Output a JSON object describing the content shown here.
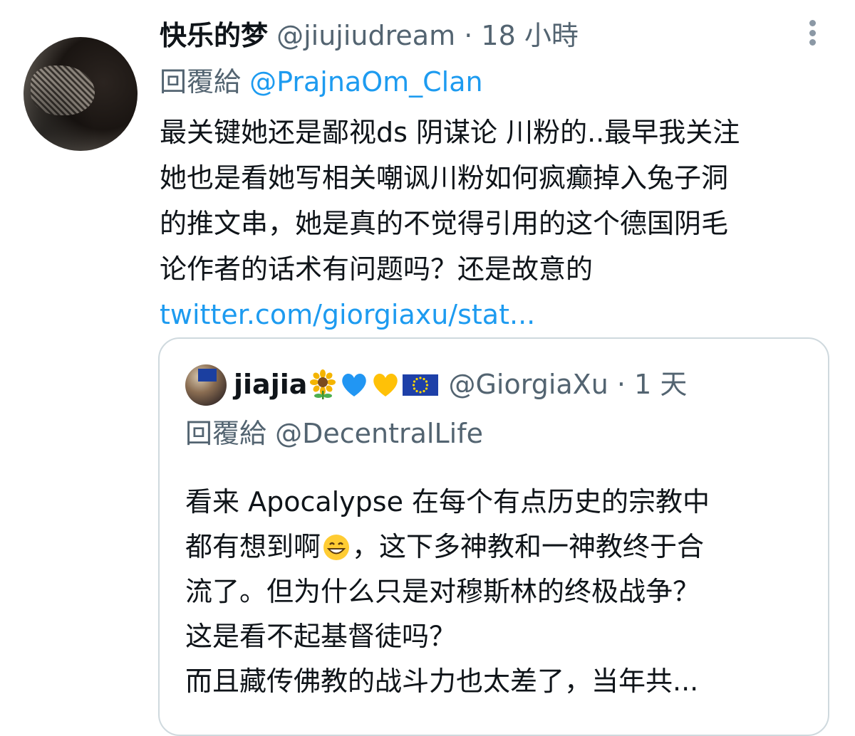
{
  "tweet": {
    "display_name": "快乐的梦",
    "handle": "@jiujiudream",
    "separator": "·",
    "time": "18 小時",
    "reply_prefix": "回覆給",
    "reply_to": "@PrajnaOm_Clan",
    "text_lines": [
      "最关键她还是鄙视ds 阴谋论 川粉的..最早我关注",
      "她也是看她写相关嘲讽川粉如何疯癫掉入兔子洞",
      "的推文串，她是真的不觉得引用的这个德国阴毛",
      "论作者的话术有问题吗？还是故意的"
    ],
    "link": "twitter.com/giorgiaxu/stat..."
  },
  "quote": {
    "display_name": "jiajia",
    "name_emojis": [
      "sunflower-emoji",
      "blue-heart-emoji",
      "yellow-heart-emoji",
      "eu-flag-emoji"
    ],
    "handle": "@GiorgiaXu",
    "separator": "·",
    "time": "1 天",
    "reply_prefix": "回覆給",
    "reply_to": "@DecentralLife",
    "text_lines": [
      "看来 Apocalypse 在每个有点历史的宗教中",
      "都有想到啊",
      "，这下多神教和一神教终于合",
      "流了。但为什么只是对穆斯林的终极战争？",
      "这是看不起基督徒吗？",
      "而且藏传佛教的战斗力也太差了，当年共..."
    ]
  },
  "colors": {
    "text": "#0f1419",
    "muted": "#536471",
    "link": "#1d9bf0",
    "border": "#cfd9de"
  }
}
